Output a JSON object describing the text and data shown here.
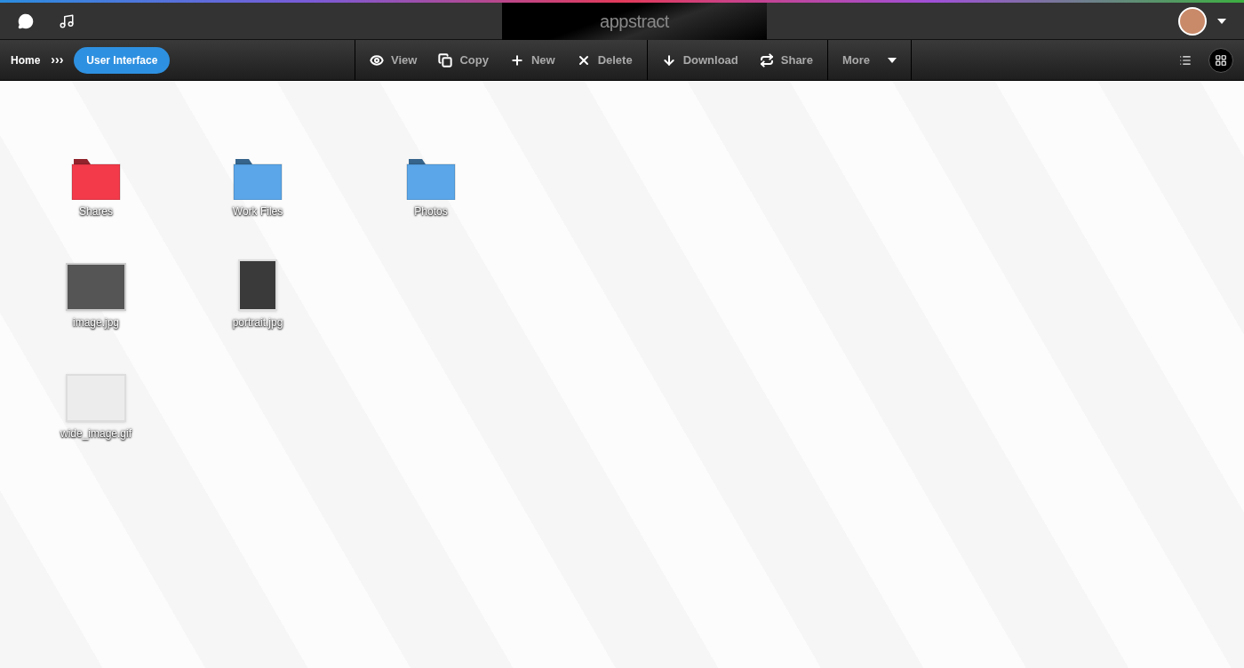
{
  "top_bar": {
    "logo": "appstract"
  },
  "breadcrumb": {
    "home": "Home",
    "separator": "›››",
    "current": "User Interface"
  },
  "toolbar": {
    "groups": [
      [
        {
          "label": "View",
          "kind": "view"
        },
        {
          "label": "Copy",
          "kind": "copy"
        },
        {
          "label": "New",
          "kind": "new"
        },
        {
          "label": "Delete",
          "kind": "delete"
        }
      ],
      [
        {
          "label": "Download",
          "kind": "download"
        },
        {
          "label": "Share",
          "kind": "share"
        }
      ],
      [
        {
          "label": "More",
          "kind": "menu"
        }
      ]
    ]
  },
  "view_modes": [
    {
      "kind": "list",
      "selected": false
    },
    {
      "kind": "grid",
      "selected": true
    }
  ],
  "items": [
    {
      "name": "Shares",
      "kind": "folder",
      "color": "#f23a4a"
    },
    {
      "name": "Work Files",
      "kind": "folder",
      "color": "#5aa6e8"
    },
    {
      "name": "Photos",
      "kind": "folder",
      "color": "#5aa6e8"
    },
    {
      "name": "image.jpg",
      "kind": "photo"
    },
    {
      "name": "portrait.jpg",
      "kind": "portrait"
    },
    {
      "name": "wide_image.gif",
      "kind": "wide"
    }
  ]
}
